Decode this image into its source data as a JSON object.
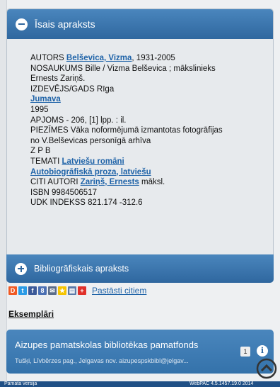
{
  "panel": {
    "title": "Īsais apraksts",
    "record": {
      "author_prefix": "AUTORS ",
      "author_link": "Belševica, Vizma",
      "author_suffix": ", 1931-2005",
      "title_line1": "NOSAUKUMS Bille / Vizma Belševica ; mākslinieks",
      "title_line2": "Ernests Zariņš.",
      "publisher_label": "IZDEVĒJS/GADS Rīga",
      "publisher_link": "Jumava",
      "year": "1995",
      "extent": "APJOMS - 206, [1] lpp. : il.",
      "notes_line1": "PIEZĪMES Vāka noformējumā izmantotas fotogrāfijas",
      "notes_line2": "no V.Belševicas personīgā arhīva",
      "zpb": "Z P B",
      "topics_prefix": "TEMATI ",
      "topic1": "Latviešu romāni",
      "topic2": "Autobiogrāfiskā proza, latviešu",
      "other_authors_prefix": "CITI AUTORI ",
      "other_author_link": "Zariņš, Ernests",
      "other_author_suffix": " māksl.",
      "isbn": "ISBN 9984506517",
      "udk": "UDK INDEKSS 821.174 -312.6"
    }
  },
  "biblio_panel": {
    "title": "Bibliogrāfiskais apraksts"
  },
  "share": {
    "link_label": "Pastāsti citiem",
    "icons": [
      {
        "name": "draugiem-icon",
        "color": "#f05a24",
        "glyph": "D"
      },
      {
        "name": "twitter-icon",
        "color": "#2b9be6",
        "glyph": "t"
      },
      {
        "name": "facebook-icon",
        "color": "#3b5998",
        "glyph": "f"
      },
      {
        "name": "google-icon",
        "color": "#4a6fb3",
        "glyph": "8"
      },
      {
        "name": "email-icon",
        "color": "#5b6d8a",
        "glyph": "✉"
      },
      {
        "name": "favorite-icon",
        "color": "#f5c400",
        "glyph": "★"
      },
      {
        "name": "print-icon",
        "color": "#5b7aa8",
        "glyph": "▤"
      },
      {
        "name": "more-icon",
        "color": "#e0302a",
        "glyph": "+"
      }
    ]
  },
  "copies": {
    "heading": "Eksemplāri",
    "library": {
      "title": "Aizupes pamatskolas bibliotēkas pamatfonds",
      "subtitle": "Tušķi, Līvbērzes pag., Jelgavas nov. aizupespskbibl@jelgav...",
      "count": "1"
    }
  },
  "footer": {
    "left_text": "Pamata versija",
    "right_text": "WebPAC 4.5.1457.19.0 2014"
  }
}
